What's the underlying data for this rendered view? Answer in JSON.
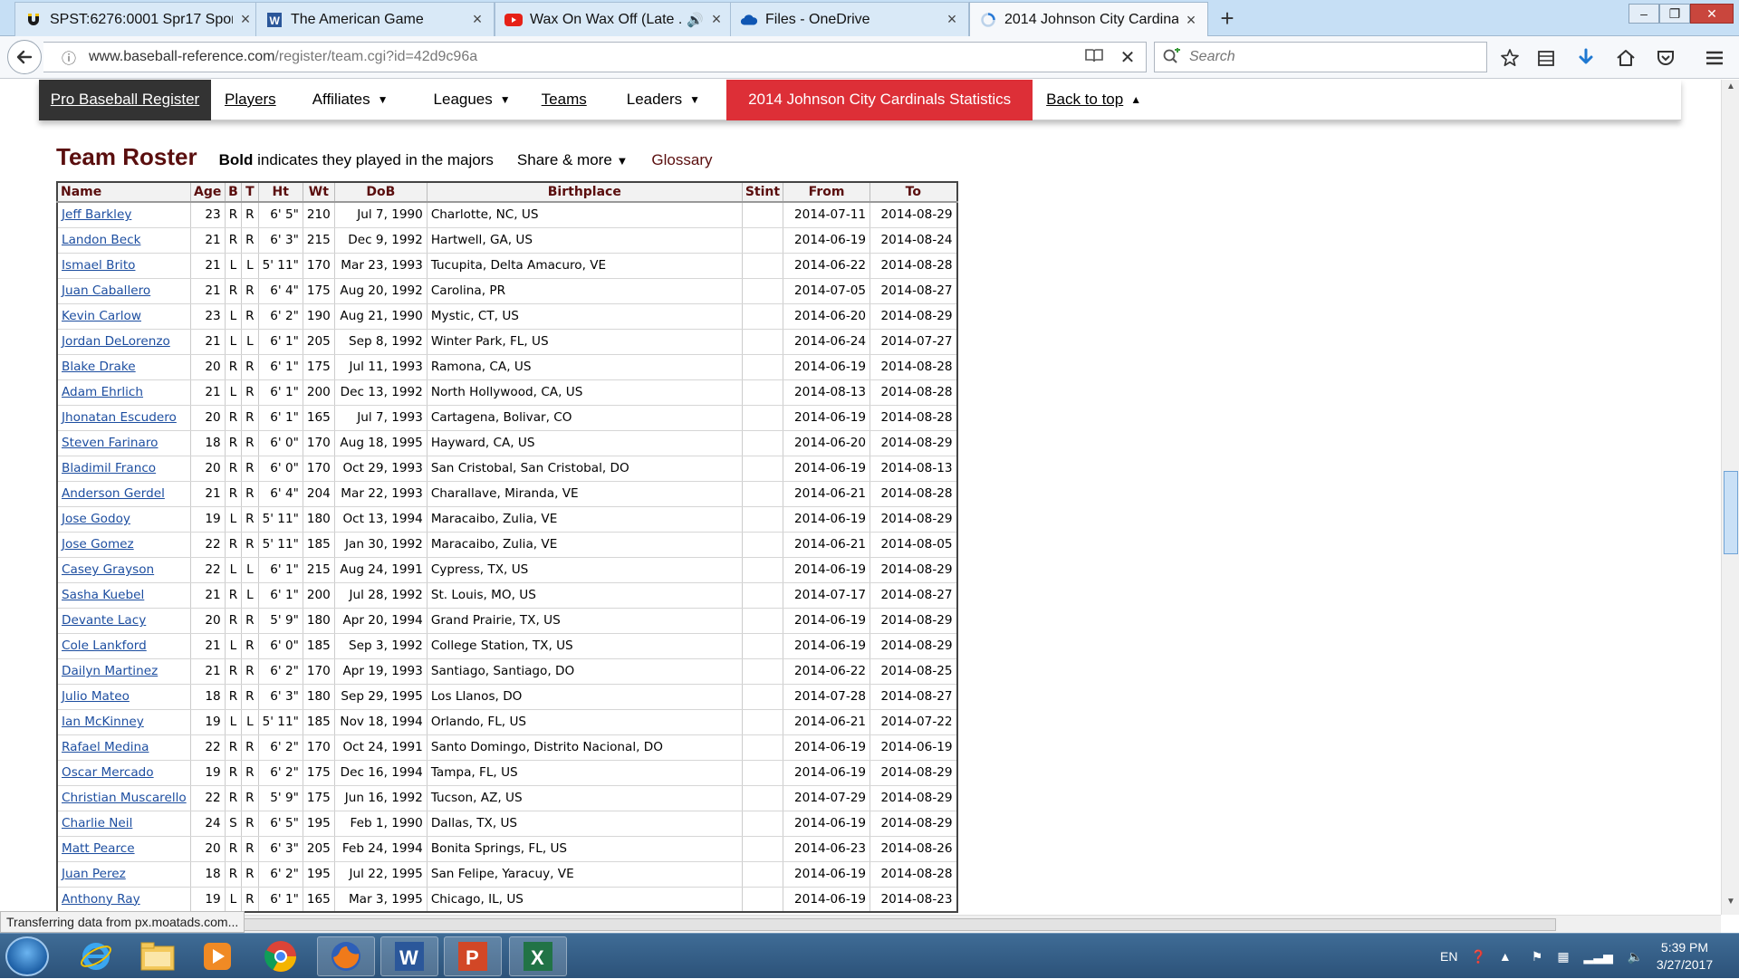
{
  "browser": {
    "tabs": [
      {
        "title": "SPST:6276:0001 Spr17 Spor...",
        "icon": "horseshoe-icon",
        "muted": false
      },
      {
        "title": "The American Game",
        "icon": "word-doc-icon",
        "muted": false
      },
      {
        "title": "Wax On Wax Off (Late ...",
        "icon": "youtube-icon",
        "muted": true
      },
      {
        "title": "Files - OneDrive",
        "icon": "onedrive-icon",
        "muted": false
      },
      {
        "title": "2014 Johnson City Cardinal...",
        "icon": "loading-icon",
        "muted": false
      }
    ],
    "url_domain": "www.baseball-reference.com",
    "url_path": "/register/team.cgi?id=42d9c96a",
    "search_placeholder": "Search",
    "status_text": "Transferring data from px.moatads.com..."
  },
  "site_nav": {
    "brand": "Pro Baseball Register",
    "players": "Players",
    "affiliates": "Affiliates",
    "leagues": "Leagues",
    "teams": "Teams",
    "leaders": "Leaders",
    "current": "2014 Johnson City Cardinals Statistics",
    "back_to_top": "Back to top",
    "caret_down": "▼",
    "caret_up": "▲"
  },
  "roster": {
    "title": "Team Roster",
    "note_bold": "Bold",
    "note_rest": " indicates they played in the majors",
    "share": "Share & more",
    "glossary": "Glossary",
    "columns": [
      "Name",
      "Age",
      "B",
      "T",
      "Ht",
      "Wt",
      "DoB",
      "Birthplace",
      "Stint",
      "From",
      "To"
    ],
    "rows": [
      [
        "Jeff Barkley",
        "23",
        "R",
        "R",
        "6' 5\"",
        "210",
        "Jul 7, 1990",
        "Charlotte, NC, US",
        "",
        "2014-07-11",
        "2014-08-29"
      ],
      [
        "Landon Beck",
        "21",
        "R",
        "R",
        "6' 3\"",
        "215",
        "Dec 9, 1992",
        "Hartwell, GA, US",
        "",
        "2014-06-19",
        "2014-08-24"
      ],
      [
        "Ismael Brito",
        "21",
        "L",
        "L",
        "5' 11\"",
        "170",
        "Mar 23, 1993",
        "Tucupita, Delta Amacuro, VE",
        "",
        "2014-06-22",
        "2014-08-28"
      ],
      [
        "Juan Caballero",
        "21",
        "R",
        "R",
        "6' 4\"",
        "175",
        "Aug 20, 1992",
        "Carolina, PR",
        "",
        "2014-07-05",
        "2014-08-27"
      ],
      [
        "Kevin Carlow",
        "23",
        "L",
        "R",
        "6' 2\"",
        "190",
        "Aug 21, 1990",
        "Mystic, CT, US",
        "",
        "2014-06-20",
        "2014-08-29"
      ],
      [
        "Jordan DeLorenzo",
        "21",
        "L",
        "L",
        "6' 1\"",
        "205",
        "Sep 8, 1992",
        "Winter Park, FL, US",
        "",
        "2014-06-24",
        "2014-07-27"
      ],
      [
        "Blake Drake",
        "20",
        "R",
        "R",
        "6' 1\"",
        "175",
        "Jul 11, 1993",
        "Ramona, CA, US",
        "",
        "2014-06-19",
        "2014-08-28"
      ],
      [
        "Adam Ehrlich",
        "21",
        "L",
        "R",
        "6' 1\"",
        "200",
        "Dec 13, 1992",
        "North Hollywood, CA, US",
        "",
        "2014-08-13",
        "2014-08-28"
      ],
      [
        "Jhonatan Escudero",
        "20",
        "R",
        "R",
        "6' 1\"",
        "165",
        "Jul 7, 1993",
        "Cartagena, Bolivar, CO",
        "",
        "2014-06-19",
        "2014-08-28"
      ],
      [
        "Steven Farinaro",
        "18",
        "R",
        "R",
        "6' 0\"",
        "170",
        "Aug 18, 1995",
        "Hayward, CA, US",
        "",
        "2014-06-20",
        "2014-08-29"
      ],
      [
        "Bladimil Franco",
        "20",
        "R",
        "R",
        "6' 0\"",
        "170",
        "Oct 29, 1993",
        "San Cristobal, San Cristobal, DO",
        "",
        "2014-06-19",
        "2014-08-13"
      ],
      [
        "Anderson Gerdel",
        "21",
        "R",
        "R",
        "6' 4\"",
        "204",
        "Mar 22, 1993",
        "Charallave, Miranda, VE",
        "",
        "2014-06-21",
        "2014-08-28"
      ],
      [
        "Jose Godoy",
        "19",
        "L",
        "R",
        "5' 11\"",
        "180",
        "Oct 13, 1994",
        "Maracaibo, Zulia, VE",
        "",
        "2014-06-19",
        "2014-08-29"
      ],
      [
        "Jose Gomez",
        "22",
        "R",
        "R",
        "5' 11\"",
        "185",
        "Jan 30, 1992",
        "Maracaibo, Zulia, VE",
        "",
        "2014-06-21",
        "2014-08-05"
      ],
      [
        "Casey Grayson",
        "22",
        "L",
        "L",
        "6' 1\"",
        "215",
        "Aug 24, 1991",
        "Cypress, TX, US",
        "",
        "2014-06-19",
        "2014-08-29"
      ],
      [
        "Sasha Kuebel",
        "21",
        "R",
        "L",
        "6' 1\"",
        "200",
        "Jul 28, 1992",
        "St. Louis, MO, US",
        "",
        "2014-07-17",
        "2014-08-27"
      ],
      [
        "Devante Lacy",
        "20",
        "R",
        "R",
        "5' 9\"",
        "180",
        "Apr 20, 1994",
        "Grand Prairie, TX, US",
        "",
        "2014-06-19",
        "2014-08-29"
      ],
      [
        "Cole Lankford",
        "21",
        "L",
        "R",
        "6' 0\"",
        "185",
        "Sep 3, 1992",
        "College Station, TX, US",
        "",
        "2014-06-19",
        "2014-08-29"
      ],
      [
        "Dailyn Martinez",
        "21",
        "R",
        "R",
        "6' 2\"",
        "170",
        "Apr 19, 1993",
        "Santiago, Santiago, DO",
        "",
        "2014-06-22",
        "2014-08-25"
      ],
      [
        "Julio Mateo",
        "18",
        "R",
        "R",
        "6' 3\"",
        "180",
        "Sep 29, 1995",
        "Los Llanos, DO",
        "",
        "2014-07-28",
        "2014-08-27"
      ],
      [
        "Ian McKinney",
        "19",
        "L",
        "L",
        "5' 11\"",
        "185",
        "Nov 18, 1994",
        "Orlando, FL, US",
        "",
        "2014-06-21",
        "2014-07-22"
      ],
      [
        "Rafael Medina",
        "22",
        "R",
        "R",
        "6' 2\"",
        "170",
        "Oct 24, 1991",
        "Santo Domingo, Distrito Nacional, DO",
        "",
        "2014-06-19",
        "2014-06-19"
      ],
      [
        "Oscar Mercado",
        "19",
        "R",
        "R",
        "6' 2\"",
        "175",
        "Dec 16, 1994",
        "Tampa, FL, US",
        "",
        "2014-06-19",
        "2014-08-29"
      ],
      [
        "Christian Muscarello",
        "22",
        "R",
        "R",
        "5' 9\"",
        "175",
        "Jun 16, 1992",
        "Tucson, AZ, US",
        "",
        "2014-07-29",
        "2014-08-29"
      ],
      [
        "Charlie Neil",
        "24",
        "S",
        "R",
        "6' 5\"",
        "195",
        "Feb 1, 1990",
        "Dallas, TX, US",
        "",
        "2014-06-19",
        "2014-08-29"
      ],
      [
        "Matt Pearce",
        "20",
        "R",
        "R",
        "6' 3\"",
        "205",
        "Feb 24, 1994",
        "Bonita Springs, FL, US",
        "",
        "2014-06-23",
        "2014-08-26"
      ],
      [
        "Juan Perez",
        "18",
        "R",
        "R",
        "6' 2\"",
        "195",
        "Jul 22, 1995",
        "San Felipe, Yaracuy, VE",
        "",
        "2014-06-19",
        "2014-08-28"
      ],
      [
        "Anthony Ray",
        "19",
        "L",
        "R",
        "6' 1\"",
        "165",
        "Mar 3, 1995",
        "Chicago, IL, US",
        "",
        "2014-06-19",
        "2014-08-23"
      ]
    ]
  },
  "taskbar": {
    "apps": [
      "start-orb-icon",
      "internet-explorer-icon",
      "file-explorer-icon",
      "media-player-icon",
      "chrome-icon",
      "firefox-icon",
      "word-icon",
      "powerpoint-icon",
      "excel-icon"
    ],
    "language": "EN",
    "time": "5:39 PM",
    "date": "3/27/2017"
  },
  "colors": {
    "accent_red": "#dd2f37",
    "title_maroon": "#5a0e0e",
    "link_blue": "#1d4ea0",
    "brand_dark": "#333333"
  }
}
